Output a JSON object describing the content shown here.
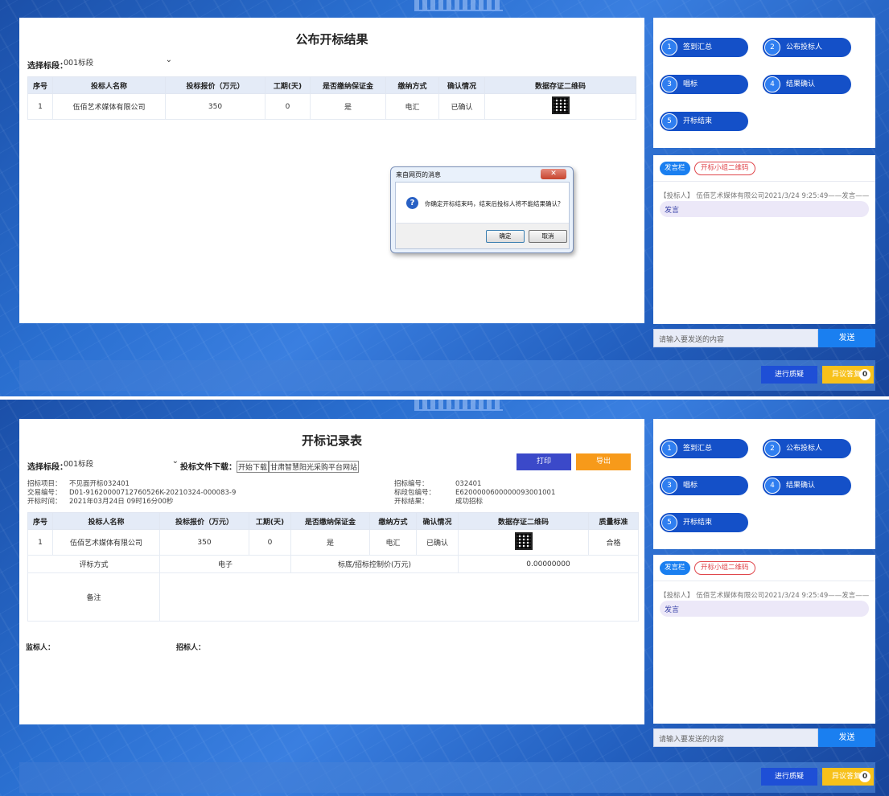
{
  "screen1": {
    "title": "公布开标结果",
    "segment_label": "选择标段：",
    "segment_value": "001标段",
    "table": {
      "headers": [
        "序号",
        "投标人名称",
        "投标报价（万元）",
        "工期(天)",
        "是否缴纳保证金",
        "缴纳方式",
        "确认情况",
        "数据存证二维码"
      ],
      "rows": [
        [
          "1",
          "伍佰艺术媒体有限公司",
          "350",
          "0",
          "是",
          "电汇",
          "已确认"
        ]
      ]
    },
    "dialog": {
      "title": "来自网页的消息",
      "message": "你确定开标结束吗，结束后投标人将不能结果确认？",
      "ok": "确定",
      "cancel": "取消"
    }
  },
  "screen2": {
    "title": "开标记录表",
    "segment_label": "选择标段：",
    "segment_value": "001标段",
    "download_label": "投标文件下载：",
    "download_link1": "开始下载",
    "download_link2": "甘肃智慧阳光采购平台网站",
    "print": "打印",
    "export": "导出",
    "info_left": [
      {
        "k": "招标项目：",
        "v": "不见面开标032401"
      },
      {
        "k": "交易编号：",
        "v": "D01-91620000712760526K-20210324-000083-9"
      },
      {
        "k": "开标时间：",
        "v": "2021年03月24日 09时16分00秒"
      }
    ],
    "info_right": [
      {
        "k": "招标编号：",
        "v": "032401"
      },
      {
        "k": "标段包编号：",
        "v": "E6200000600000093001001"
      },
      {
        "k": "开标结果：",
        "v": "成功招标"
      }
    ],
    "table": {
      "headers": [
        "序号",
        "投标人名称",
        "投标报价（万元）",
        "工期(天)",
        "是否缴纳保证金",
        "缴纳方式",
        "确认情况",
        "数据存证二维码",
        "质量标准"
      ],
      "rows": [
        [
          "1",
          "伍佰艺术媒体有限公司",
          "350",
          "0",
          "是",
          "电汇",
          "已确认",
          "",
          "合格"
        ]
      ]
    },
    "eval_label": "评标方式",
    "eval_value": "电子",
    "ceiling_label": "标底/招标控制价(万元)",
    "ceiling_value": "0.00000000",
    "remark_label": "备注",
    "supervisor": "监标人：",
    "tenderer": "招标人："
  },
  "side": {
    "steps": [
      {
        "num": "1",
        "label": "签到汇总"
      },
      {
        "num": "2",
        "label": "公布投标人"
      },
      {
        "num": "3",
        "label": "唱标"
      },
      {
        "num": "4",
        "label": "结果确认"
      },
      {
        "num": "5",
        "label": "开标结束"
      }
    ],
    "chat_tab_active": "发言栏",
    "chat_tab_qr": "开标小组二维码",
    "chat_message": "【投标人】 伍佰艺术媒体有限公司2021/3/24 9:25:49——发言——",
    "chat_bubble": "发言",
    "send_placeholder": "请输入要发送的内容",
    "send_button": "发送",
    "question_button": "进行质疑",
    "objection_button": "异议答复",
    "objection_count": "0"
  },
  "colors": {
    "primary": "#1450c8",
    "accent": "#1a7ff0",
    "warning": "#f7c11a",
    "export": "#f79a1a",
    "print": "#3b49c9",
    "confirmed": "#2d9d32"
  }
}
